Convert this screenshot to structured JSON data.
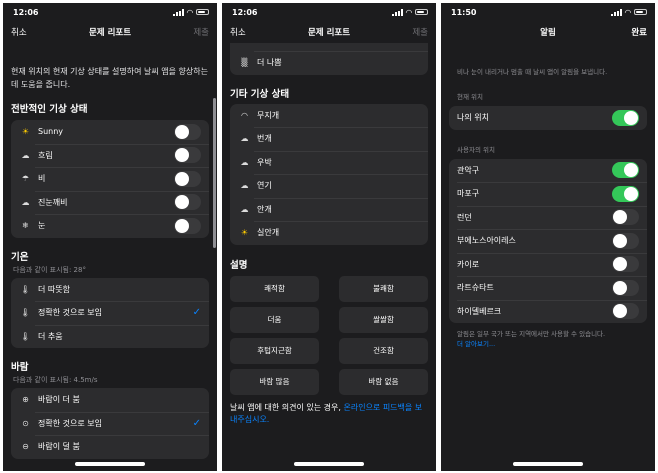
{
  "screen1": {
    "time": "12:06",
    "nav": {
      "cancel": "취소",
      "title": "문제 리포트",
      "submit": "제출"
    },
    "description": "현재 위치의 현재 기상 상태를 설명하여 날씨 앱을 향상하는 데 도움을 줍니다.",
    "overall": {
      "heading": "전반적인 기상 상태",
      "items": [
        {
          "label": "Sunny",
          "icon": "sun-icon",
          "toggle": false
        },
        {
          "label": "흐림",
          "icon": "cloud-icon",
          "toggle": false
        },
        {
          "label": "비",
          "icon": "rain-icon",
          "toggle": false
        },
        {
          "label": "진눈깨비",
          "icon": "sleet-icon",
          "toggle": false
        },
        {
          "label": "눈",
          "icon": "snowflake-icon",
          "toggle": false
        }
      ]
    },
    "temperature": {
      "heading": "기온",
      "shown": "다음과 같이 표시됨: 28°",
      "items": [
        {
          "label": "더 따뜻함",
          "icon": "thermometer-high-icon",
          "checked": false
        },
        {
          "label": "정확한 것으로 보임",
          "icon": "thermometer-mid-icon",
          "checked": true
        },
        {
          "label": "더 추움",
          "icon": "thermometer-low-icon",
          "checked": false
        }
      ]
    },
    "wind": {
      "heading": "바람",
      "shown": "다음과 같이 표시됨: 4.5m/s",
      "items": [
        {
          "label": "바람이 더 붐",
          "icon": "wind-up-icon",
          "checked": false
        },
        {
          "label": "정확한 것으로 보임",
          "icon": "wind-ok-icon",
          "checked": true
        },
        {
          "label": "바람이 덜 붐",
          "icon": "wind-down-icon",
          "checked": false
        }
      ]
    }
  },
  "screen2": {
    "time": "12:06",
    "nav": {
      "cancel": "취소",
      "title": "문제 리포트",
      "submit": "제출"
    },
    "top_items": [
      {
        "label": "더 나쁨",
        "icon": "haze-icon"
      }
    ],
    "other": {
      "heading": "기타 기상 상태",
      "items": [
        {
          "label": "무지개",
          "icon": "rainbow-icon"
        },
        {
          "label": "번개",
          "icon": "lightning-icon"
        },
        {
          "label": "우박",
          "icon": "hail-icon"
        },
        {
          "label": "연기",
          "icon": "smoke-icon"
        },
        {
          "label": "안개",
          "icon": "fog-icon"
        },
        {
          "label": "실안개",
          "icon": "mist-icon"
        }
      ]
    },
    "description": {
      "heading": "설명",
      "buttons": [
        "쾌적함",
        "불쾌함",
        "더움",
        "쌀쌀함",
        "후텁지근함",
        "건조함",
        "바람 많음",
        "바람 없음"
      ]
    },
    "feedback_prefix": "날씨 앱에 대한 의견이 있는 경우, ",
    "feedback_link": "온라인으로 피드백을 보내주십시오."
  },
  "screen3": {
    "time": "11:50",
    "nav": {
      "title": "알림",
      "done": "완료"
    },
    "intro": "비나 눈이 내리거나 멈출 때 날씨 앱이 알림을 보냅니다.",
    "current": {
      "label": "현재 위치",
      "items": [
        {
          "label": "나의 위치",
          "toggle": true
        }
      ]
    },
    "user": {
      "label": "사용자의 위치",
      "items": [
        {
          "label": "관악구",
          "toggle": true
        },
        {
          "label": "마포구",
          "toggle": true
        },
        {
          "label": "런던",
          "toggle": false
        },
        {
          "label": "부에노스아이레스",
          "toggle": false
        },
        {
          "label": "카이로",
          "toggle": false
        },
        {
          "label": "라트슈타트",
          "toggle": false
        },
        {
          "label": "하이델베르크",
          "toggle": false
        }
      ]
    },
    "footnote": "알림은 일부 국가 또는 지역에서만 사용할 수 있습니다.",
    "learn_more": "더 알아보기..."
  }
}
